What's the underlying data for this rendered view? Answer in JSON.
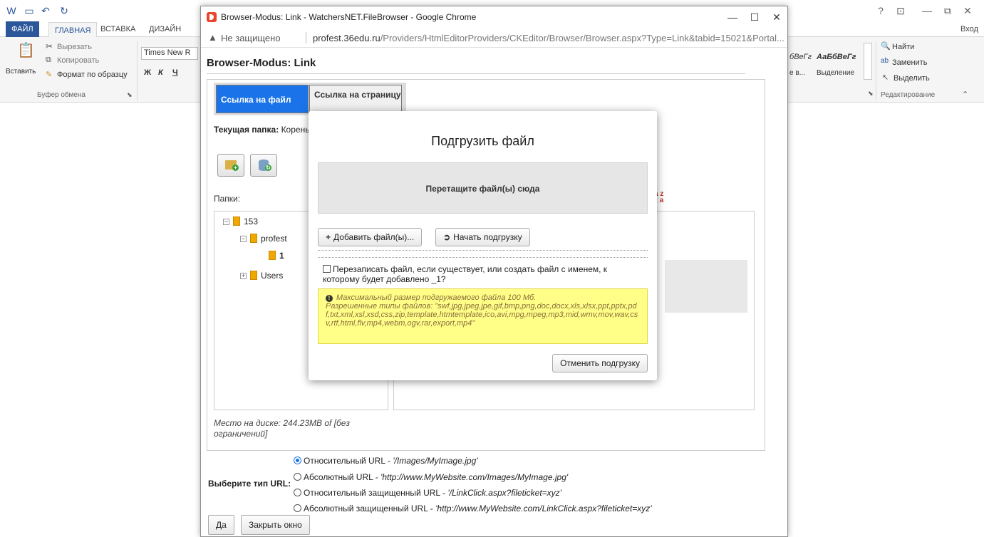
{
  "word": {
    "tabs": [
      "ФАЙЛ",
      "ГЛАВНАЯ",
      "ВСТАВКА",
      "ДИЗАЙН"
    ],
    "signin": "Вход",
    "title_controls": [
      "?",
      "⊡",
      "—",
      "⧉",
      "✕"
    ],
    "clipboard": {
      "paste": "Вставить",
      "cut": "Вырезать",
      "copy": "Копировать",
      "format_painter": "Формат по образцу",
      "group": "Буфер обмена"
    },
    "font": {
      "name": "Times New R",
      "bold": "Ж",
      "italic": "К",
      "underline": "Ч"
    },
    "styles": {
      "sample1": "бВеГг",
      "sample2": "АаБбВеГг",
      "label1": "е в...",
      "label2": "Выделение"
    },
    "editing": {
      "find": "Найти",
      "replace": "Заменить",
      "select": "Выделить",
      "group": "Редактирование"
    }
  },
  "chrome": {
    "title": "Browser-Modus: Link - WatchersNET.FileBrowser - Google Chrome",
    "not_secure": "Не защищено",
    "url_host": "profest.36edu.ru",
    "url_path": "/Providers/HtmlEditorProviders/CKEditor/Browser/Browser.aspx?Type=Link&tabid=15021&Portal..."
  },
  "browser": {
    "heading": "Browser-Modus: Link",
    "tab_file": "Ссылка на файл",
    "tab_page": "Ссылка на страницу",
    "current_folder_label": "Текущая папка:",
    "current_folder_value": "Корень",
    "folders_label": "Папки:",
    "tree": {
      "root": "153",
      "child1": "profest",
      "grandchild": "1",
      "child2": "Users"
    },
    "disk_space": "Место на диске: 244.23MB of [без ограничений]",
    "url_type_label": "Выберите тип URL:",
    "url_options": [
      {
        "label": "Относительный URL - ",
        "example": "'/Images/MyImage.jpg'",
        "selected": true
      },
      {
        "label": "Абсолютный URL - ",
        "example": "'http://www.MyWebsite.com/Images/MyImage.jpg'",
        "selected": false
      },
      {
        "label": "Относительный защищенный URL - ",
        "example": "'/LinkClick.aspx?fileticket=xyz'",
        "selected": false
      },
      {
        "label": "Абсолютный защищенный URL - ",
        "example": "'http://www.MyWebsite.com/LinkClick.aspx?fileticket=xyz'",
        "selected": false
      }
    ],
    "ok": "Да",
    "close": "Закрыть окно"
  },
  "upload": {
    "title": "Подгрузить файл",
    "dropzone": "Перетащите файл(ы) сюда",
    "add_files": "Добавить файл(ы)...",
    "start_upload": "Начать подгрузку",
    "overwrite": "Перезаписать файл, если существует, или создать файл с именем, к которому будет добавлено _1?",
    "max_size": "Максимальный размер подгружаемого файла 100 Мб.",
    "allowed_types": "Разрешенные типы файлов: \"swf,jpg,jpeg,jpe,gif,bmp,png,doc,docx,xls,xlsx,ppt,pptx,pdf,txt,xml,xsl,xsd,css,zip,template,htmtemplate,ico,avi,mpg,mpeg,mp3,mid,wmv,mov,wav,csv,rtf,html,flv,mp4,webm,ogv,rar,export,mp4\"",
    "cancel": "Отменить подгрузку"
  }
}
